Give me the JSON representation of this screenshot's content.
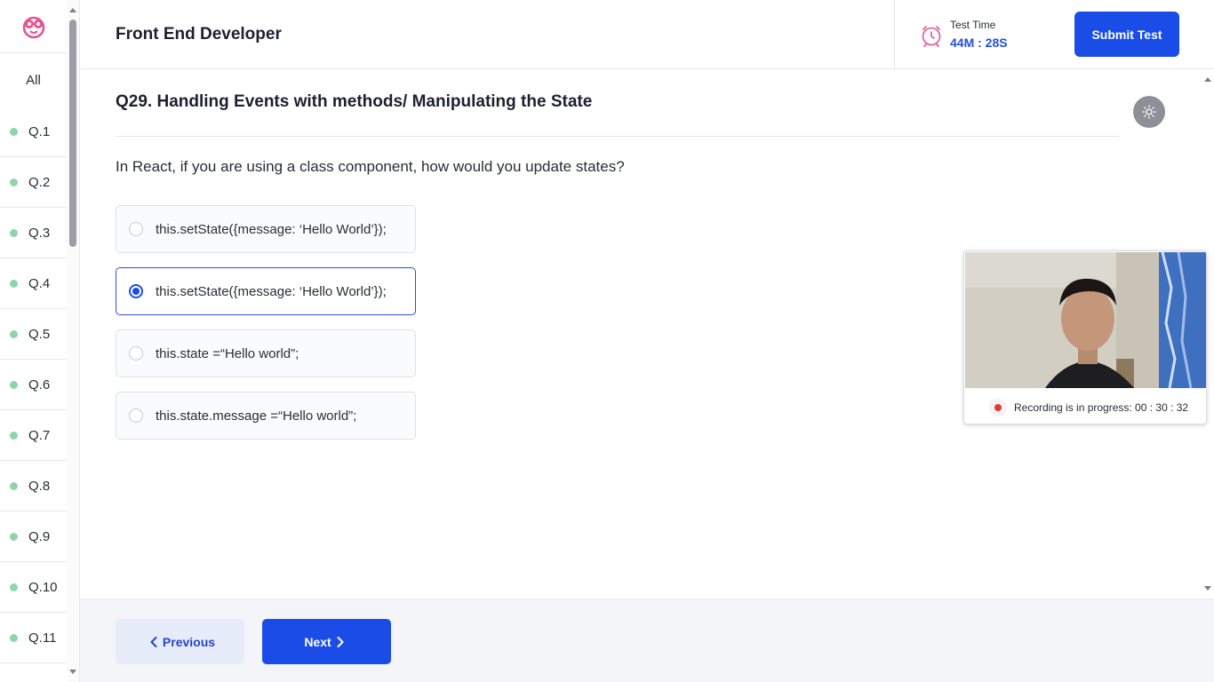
{
  "header": {
    "title": "Front End Developer",
    "timer_label": "Test Time",
    "timer_value": "44M : 28S",
    "submit_label": "Submit Test"
  },
  "sidebar": {
    "all_label": "All",
    "items": [
      "Q.1",
      "Q.2",
      "Q.3",
      "Q.4",
      "Q.5",
      "Q.6",
      "Q.7",
      "Q.8",
      "Q.9",
      "Q.10",
      "Q.11"
    ]
  },
  "question": {
    "title": "Q29. Handling Events with methods/ Manipulating the State",
    "text": "In React, if you are using a class component, how would you update states?",
    "selected_index": 1,
    "options": [
      "this.setState({message: ‘Hello World’});",
      "this.setState({message: ‘Hello World’});",
      "this.state =“Hello world”;",
      "this.state.message =“Hello world”;"
    ]
  },
  "webcam": {
    "status_text": "Recording is in progress: 00 : 30 : 32"
  },
  "footer": {
    "previous_label": "Previous",
    "next_label": "Next"
  },
  "colors": {
    "primary": "#1a4de8",
    "timer": "#2050e0",
    "answered_dot": "#8fd6a6",
    "recording": "#e53935",
    "clock_icon": "#e8508f",
    "logo": "#e8508f"
  },
  "icons": {
    "logo": "owl-face-logo",
    "timer": "clock-icon",
    "theme": "sun-icon",
    "record": "record-dot-icon",
    "previous": "chevron-left-icon",
    "next": "chevron-right-icon"
  }
}
